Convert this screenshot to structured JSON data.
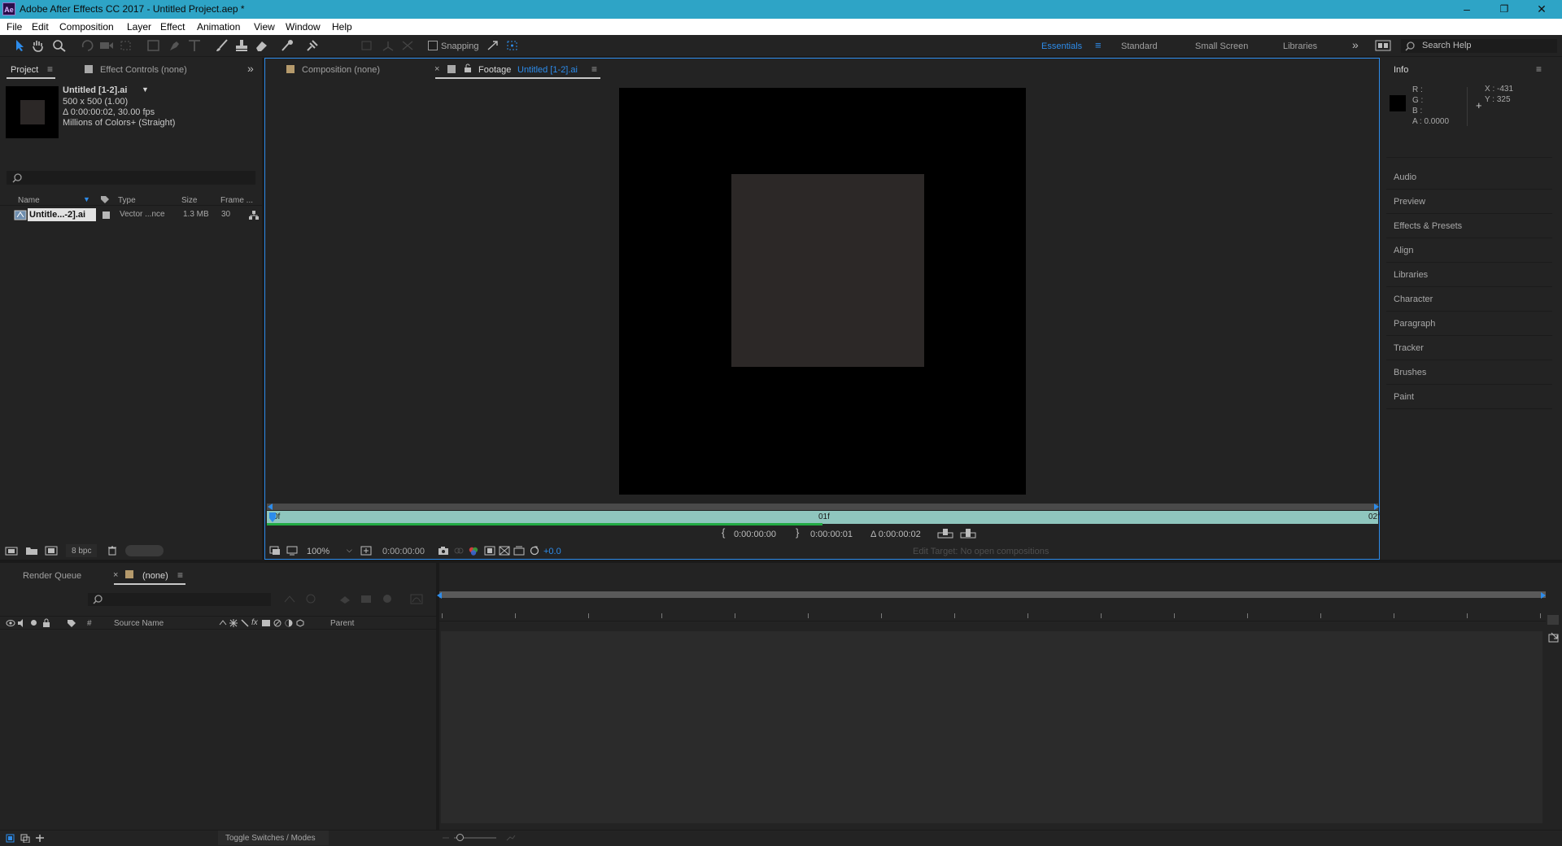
{
  "titlebar": {
    "icon": "Ae",
    "title": "Adobe After Effects CC 2017 - Untitled Project.aep *",
    "minimize": "–",
    "maximize": "❐",
    "close": "✕"
  },
  "menu": [
    "File",
    "Edit",
    "Composition",
    "Layer",
    "Effect",
    "Animation",
    "View",
    "Window",
    "Help"
  ],
  "toolbar": {
    "snapping_label": "Snapping",
    "workspaces": [
      "Essentials",
      "Standard",
      "Small Screen",
      "Libraries"
    ],
    "active_workspace": "Essentials",
    "search_placeholder": "Search Help",
    "more": "»"
  },
  "project_panel": {
    "tab_project": "Project",
    "tab_effect_controls": "Effect Controls (none)",
    "item_name": "Untitled [1-2].ai",
    "item_dims": "500 x 500 (1.00)",
    "item_duration": "Δ 0:00:00:02, 30.00 fps",
    "item_colors": "Millions of Colors+ (Straight)",
    "columns": [
      "Name",
      "Type",
      "Size",
      "Frame ..."
    ],
    "rows": [
      {
        "name": "Untitle...-2].ai",
        "type": "Vector ...nce",
        "size": "1.3 MB",
        "frame": "30"
      }
    ],
    "bpc": "8 bpc"
  },
  "viewer": {
    "tab_composition": "Composition (none)",
    "tab_footage_prefix": "Footage",
    "tab_footage_name": "Untitled [1-2].ai",
    "ruler_start": "0f",
    "ruler_mid": "01f",
    "ruler_end": "02f",
    "in_point": "0:00:00:00",
    "out_point": "0:00:00:01",
    "duration": "Δ 0:00:00:02",
    "zoom": "100%",
    "current_time": "0:00:00:00",
    "exposure": "+0.0",
    "edit_target": "Edit Target: No open compositions"
  },
  "info_panel": {
    "title": "Info",
    "r": "R :",
    "g": "G :",
    "b": "B :",
    "a": "A :  0.0000",
    "x": "X : -431",
    "y": "Y :  325"
  },
  "side_panels": [
    "Audio",
    "Preview",
    "Effects & Presets",
    "Align",
    "Libraries",
    "Character",
    "Paragraph",
    "Tracker",
    "Brushes",
    "Paint"
  ],
  "timeline": {
    "tab_render_queue": "Render Queue",
    "tab_none": "(none)",
    "col_number": "#",
    "col_source": "Source Name",
    "col_parent": "Parent",
    "toggle_label": "Toggle Switches / Modes"
  },
  "colors": {
    "accent": "#2d8ceb",
    "titlebar": "#2ea4c6",
    "timebar": "#8fc6be",
    "work_area_green": "#22aa44"
  }
}
